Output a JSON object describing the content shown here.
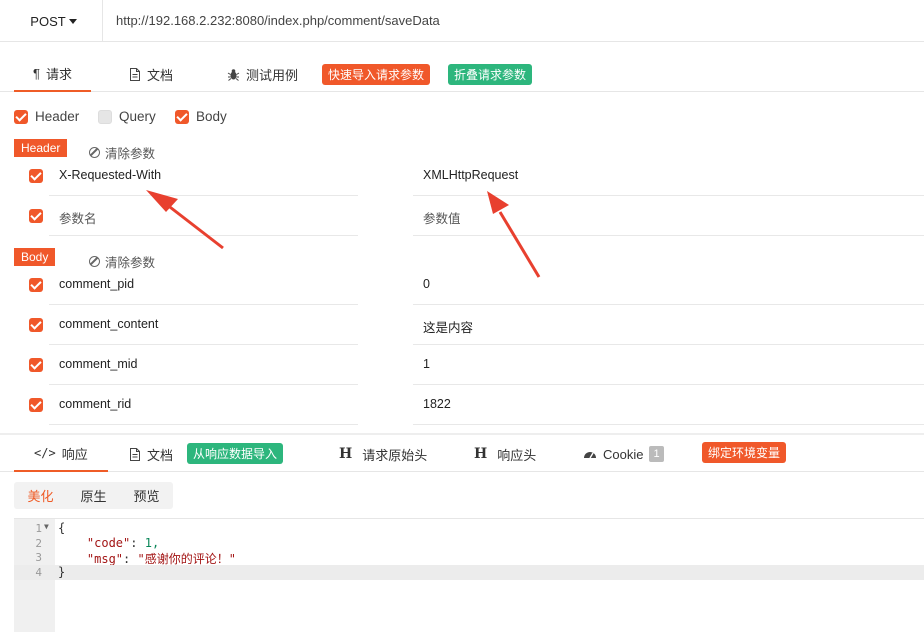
{
  "request": {
    "method": "POST",
    "url": "http://192.168.2.232:8080/index.php/comment/saveData"
  },
  "request_tabs": [
    {
      "label": "请求",
      "icon": "paragraph-icon",
      "active": true
    },
    {
      "label": "文档",
      "icon": "document-icon"
    },
    {
      "label": "测试用例",
      "icon": "bug-icon"
    }
  ],
  "request_actions": {
    "quick_import": "快速导入请求参数",
    "collapse": "折叠请求参数"
  },
  "filters": [
    {
      "label": "Header",
      "checked": true
    },
    {
      "label": "Query",
      "checked": false
    },
    {
      "label": "Body",
      "checked": true
    }
  ],
  "header_section": {
    "label": "Header",
    "clear": "清除参数",
    "rows": [
      {
        "key": "X-Requested-With",
        "value": "XMLHttpRequest",
        "checked": true
      },
      {
        "key": "参数名",
        "value": "参数值",
        "checked": true,
        "placeholder": true
      }
    ]
  },
  "body_section": {
    "label": "Body",
    "clear": "清除参数",
    "rows": [
      {
        "key": "comment_pid",
        "value": "0",
        "checked": true
      },
      {
        "key": "comment_content",
        "value": "这是内容",
        "checked": true
      },
      {
        "key": "comment_mid",
        "value": "1",
        "checked": true
      },
      {
        "key": "comment_rid",
        "value": "1822",
        "checked": true
      }
    ]
  },
  "response_tabs": {
    "response": "响应",
    "docs": "文档",
    "import_from_response": "从响应数据导入",
    "raw_request_headers": "请求原始头",
    "response_headers": "响应头",
    "cookie": "Cookie",
    "cookie_count": "1",
    "bind_env": "绑定环境变量"
  },
  "view_modes": [
    "美化",
    "原生",
    "预览"
  ],
  "response_body": {
    "lines": [
      {
        "num": "1",
        "text": "{"
      },
      {
        "num": "2",
        "key": "\"code\"",
        "value": "1,"
      },
      {
        "num": "3",
        "key": "\"msg\"",
        "value": "\"感谢你的评论！\""
      },
      {
        "num": "4",
        "text": "}"
      }
    ]
  },
  "colors": {
    "accent": "#f0582a",
    "green": "#2db67d"
  }
}
